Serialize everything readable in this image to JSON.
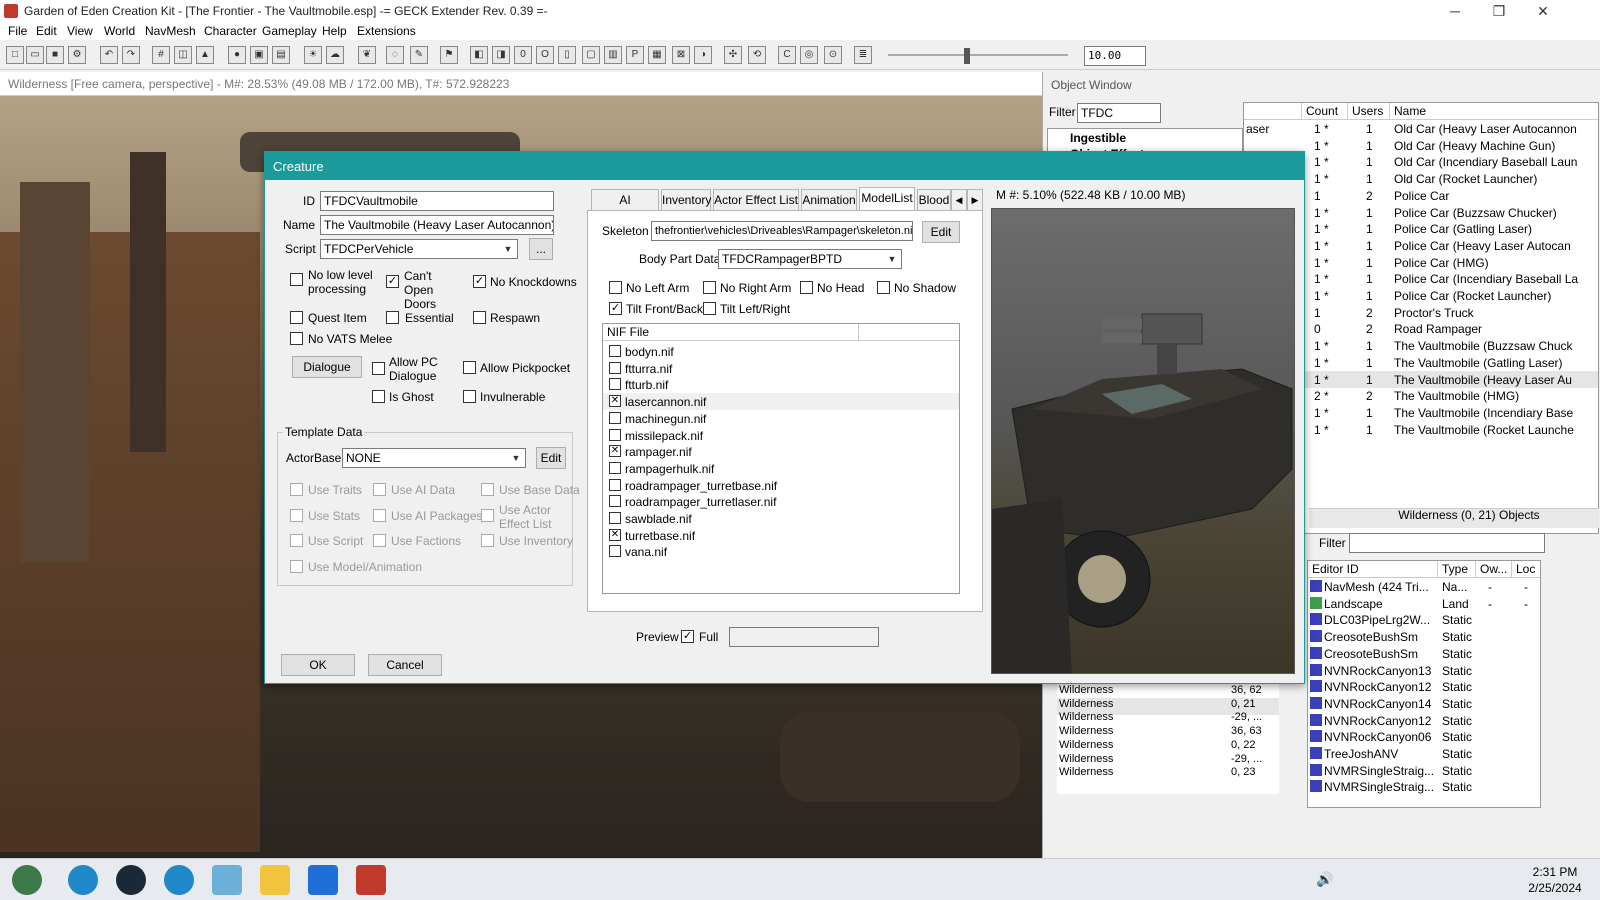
{
  "app": {
    "title": "Garden of Eden Creation Kit - [The Frontier - The Vaultmobile.esp] -= GECK Extender Rev. 0.39 =-",
    "minimize": "─",
    "restore": "❐",
    "close": "✕"
  },
  "menu": [
    "File",
    "Edit",
    "View",
    "World",
    "NavMesh",
    "Character",
    "Gameplay",
    "Help",
    "Extensions"
  ],
  "toolbar": {
    "slider_value": "10.00"
  },
  "viewport": {
    "header": "Wilderness [Free camera, perspective] - M#: 28.53% (49.08 MB / 172.00 MB), T#: 572.928223"
  },
  "object_window": {
    "title": "Object Window",
    "filter_label": "Filter",
    "filter_value": "TFDC",
    "tree_items": [
      "Ingestible",
      "Object Effect"
    ],
    "columns": [
      "",
      "Count",
      "Users",
      "Name"
    ],
    "rows": [
      {
        "edid": "aser",
        "count": "1 *",
        "users": "1",
        "name": "Old Car (Heavy Laser Autocannon"
      },
      {
        "edid": "",
        "count": "1 *",
        "users": "1",
        "name": "Old Car (Heavy Machine Gun)"
      },
      {
        "edid": "",
        "count": "1 *",
        "users": "1",
        "name": "Old Car (Incendiary Baseball Laun"
      },
      {
        "edid": "",
        "count": "1 *",
        "users": "1",
        "name": "Old Car (Rocket Launcher)"
      },
      {
        "edid": "",
        "count": "1",
        "users": "2",
        "name": "Police Car"
      },
      {
        "edid": "",
        "count": "1 *",
        "users": "1",
        "name": "Police Car (Buzzsaw Chucker)"
      },
      {
        "edid": "",
        "count": "1 *",
        "users": "1",
        "name": "Police Car (Gatling Laser)"
      },
      {
        "edid": "",
        "count": "1 *",
        "users": "1",
        "name": "Police Car (Heavy Laser Autocan"
      },
      {
        "edid": "",
        "count": "1 *",
        "users": "1",
        "name": "Police Car (HMG)"
      },
      {
        "edid": "",
        "count": "1 *",
        "users": "1",
        "name": "Police Car (Incendiary Baseball La"
      },
      {
        "edid": "",
        "count": "1 *",
        "users": "1",
        "name": "Police Car (Rocket Launcher)"
      },
      {
        "edid": "",
        "count": "1",
        "users": "2",
        "name": "Proctor's Truck"
      },
      {
        "edid": "",
        "count": "0",
        "users": "2",
        "name": "Road Rampager"
      },
      {
        "edid": "",
        "count": "1 *",
        "users": "1",
        "name": "The Vaultmobile (Buzzsaw Chuck"
      },
      {
        "edid": "",
        "count": "1 *",
        "users": "1",
        "name": "The Vaultmobile (Gatling Laser)"
      },
      {
        "edid": "",
        "count": "1 *",
        "users": "1",
        "name": "The Vaultmobile (Heavy Laser Au"
      },
      {
        "edid": "",
        "count": "2 *",
        "users": "2",
        "name": "The Vaultmobile (HMG)"
      },
      {
        "edid": "",
        "count": "1 *",
        "users": "1",
        "name": "The Vaultmobile (Incendiary Base"
      },
      {
        "edid": "",
        "count": "1 *",
        "users": "1",
        "name": "The Vaultmobile (Rocket Launche"
      }
    ]
  },
  "cell_window": {
    "title": "Wilderness (0, 21) Objects",
    "filter_label": "Filter",
    "cells": [
      {
        "name": "Wilderness",
        "coord": "36, 62"
      },
      {
        "name": "Wilderness",
        "coord": "0, 21"
      },
      {
        "name": "Wilderness",
        "coord": "-29, ..."
      },
      {
        "name": "Wilderness",
        "coord": "36, 63"
      },
      {
        "name": "Wilderness",
        "coord": "0, 22"
      },
      {
        "name": "Wilderness",
        "coord": "-29, ..."
      },
      {
        "name": "Wilderness",
        "coord": "0, 23"
      }
    ],
    "columns": [
      "Editor ID",
      "Type",
      "Ow...",
      "Loc"
    ],
    "objects": [
      {
        "id": "NavMesh (424 Tri...",
        "type": "Na...",
        "owner": "-",
        "loc": "-"
      },
      {
        "id": "Landscape",
        "type": "Land",
        "owner": "-",
        "loc": "-"
      },
      {
        "id": "DLC03PipeLrg2W...",
        "type": "Static",
        "owner": "",
        "loc": ""
      },
      {
        "id": "CreosoteBushSm",
        "type": "Static",
        "owner": "",
        "loc": ""
      },
      {
        "id": "CreosoteBushSm",
        "type": "Static",
        "owner": "",
        "loc": ""
      },
      {
        "id": "NVNRockCanyon13",
        "type": "Static",
        "owner": "",
        "loc": ""
      },
      {
        "id": "NVNRockCanyon12",
        "type": "Static",
        "owner": "",
        "loc": ""
      },
      {
        "id": "NVNRockCanyon14",
        "type": "Static",
        "owner": "",
        "loc": ""
      },
      {
        "id": "NVNRockCanyon12",
        "type": "Static",
        "owner": "",
        "loc": ""
      },
      {
        "id": "NVNRockCanyon06",
        "type": "Static",
        "owner": "",
        "loc": ""
      },
      {
        "id": "TreeJoshANV",
        "type": "Static",
        "owner": "",
        "loc": ""
      },
      {
        "id": "NVMRSingleStraig...",
        "type": "Static",
        "owner": "",
        "loc": ""
      },
      {
        "id": "NVMRSingleStraig...",
        "type": "Static",
        "owner": "",
        "loc": ""
      }
    ]
  },
  "dialog": {
    "title": "Creature",
    "id_label": "ID",
    "id_value": "TFDCVaultmobile",
    "name_label": "Name",
    "name_value": "The Vaultmobile (Heavy Laser Autocannon)",
    "script_label": "Script",
    "script_value": "TFDCPerVehicle",
    "script_browse": "...",
    "checks": {
      "no_low_level": "No low level processing",
      "cant_open_doors": "Can't Open Doors",
      "no_knockdowns": "No Knockdowns",
      "quest_item": "Quest Item",
      "essential": "Essential",
      "respawn": "Respawn",
      "no_vats_melee": "No VATS Melee",
      "allow_pc_dialogue": "Allow PC Dialogue",
      "allow_pickpocket": "Allow Pickpocket",
      "is_ghost": "Is Ghost",
      "invulnerable": "Invulnerable"
    },
    "dialogue_button": "Dialogue",
    "template": {
      "group": "Template Data",
      "actorbase_label": "ActorBase",
      "actorbase_value": "NONE",
      "edit": "Edit",
      "use_traits": "Use Traits",
      "use_ai_data": "Use AI Data",
      "use_base_data": "Use Base Data",
      "use_stats": "Use Stats",
      "use_ai_packages": "Use AI Packages",
      "use_actor_effect_list": "Use Actor Effect List",
      "use_script": "Use Script",
      "use_factions": "Use Factions",
      "use_inventory": "Use Inventory",
      "use_model_animation": "Use Model/Animation"
    },
    "ok": "OK",
    "cancel": "Cancel",
    "tabs": [
      "AI Packages",
      "Inventory",
      "Actor Effect List",
      "Animation",
      "ModelList",
      "Blood"
    ],
    "skeleton_label": "Skeleton",
    "skeleton_value": "thefrontier\\vehicles\\Driveables\\Rampager\\skeleton.nif",
    "skeleton_edit": "Edit",
    "body_part_label": "Body Part Data",
    "body_part_value": "TFDCRampagerBPTD",
    "flags": {
      "no_left_arm": "No Left Arm",
      "no_right_arm": "No Right Arm",
      "no_head": "No Head",
      "no_shadow": "No Shadow",
      "tilt_front_back": "Tilt Front/Back",
      "tilt_left_right": "Tilt Left/Right"
    },
    "nif_header": "NIF File",
    "nif_files": [
      {
        "name": "bodyn.nif",
        "checked": false
      },
      {
        "name": "ftturra.nif",
        "checked": false
      },
      {
        "name": "ftturb.nif",
        "checked": false
      },
      {
        "name": "lasercannon.nif",
        "checked": true
      },
      {
        "name": "machinegun.nif",
        "checked": false
      },
      {
        "name": "missilepack.nif",
        "checked": false
      },
      {
        "name": "rampager.nif",
        "checked": true
      },
      {
        "name": "rampagerhulk.nif",
        "checked": false
      },
      {
        "name": "roadrampager_turretbase.nif",
        "checked": false
      },
      {
        "name": "roadrampager_turretlaser.nif",
        "checked": false
      },
      {
        "name": "sawblade.nif",
        "checked": false
      },
      {
        "name": "turretbase.nif",
        "checked": true
      },
      {
        "name": "vana.nif",
        "checked": false
      }
    ],
    "memory": "M #: 5.10% (522.48 KB / 10.00 MB)",
    "preview_label": "Preview",
    "full_label": "Full"
  },
  "taskbar": {
    "time": "2:31 PM",
    "date": "2/25/2024"
  }
}
